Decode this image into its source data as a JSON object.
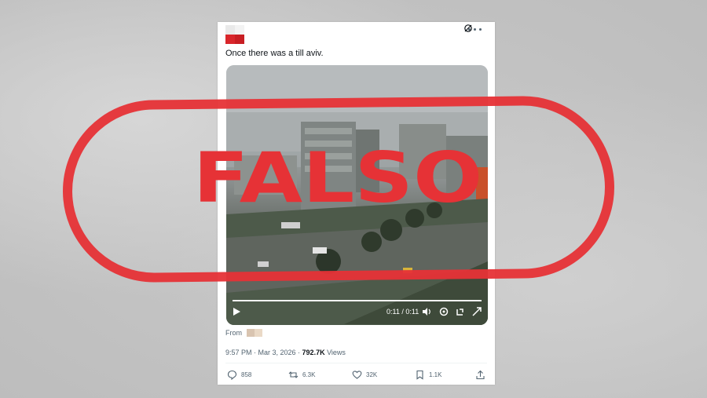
{
  "tweet": {
    "text": "Once there was a till aviv.",
    "video": {
      "time": "0:11 / 0:11",
      "progress_fraction": 1.0
    },
    "from_label": "From",
    "meta": {
      "time_date": "9:57 PM · Mar 3, 2026 · ",
      "views_count": "792.7K",
      "views_label": " Views"
    },
    "actions": {
      "replies": "858",
      "reposts": "6.3K",
      "likes": "32K",
      "bookmarks": "1.1K"
    }
  },
  "stamp": {
    "text": "FALSO",
    "color": "#e63236"
  },
  "icons": [
    "more-icon",
    "grok-icon",
    "play-icon",
    "volume-icon",
    "settings-icon",
    "rotate-icon",
    "fullscreen-icon",
    "reply-icon",
    "repost-icon",
    "like-icon",
    "bookmark-icon",
    "share-icon"
  ]
}
